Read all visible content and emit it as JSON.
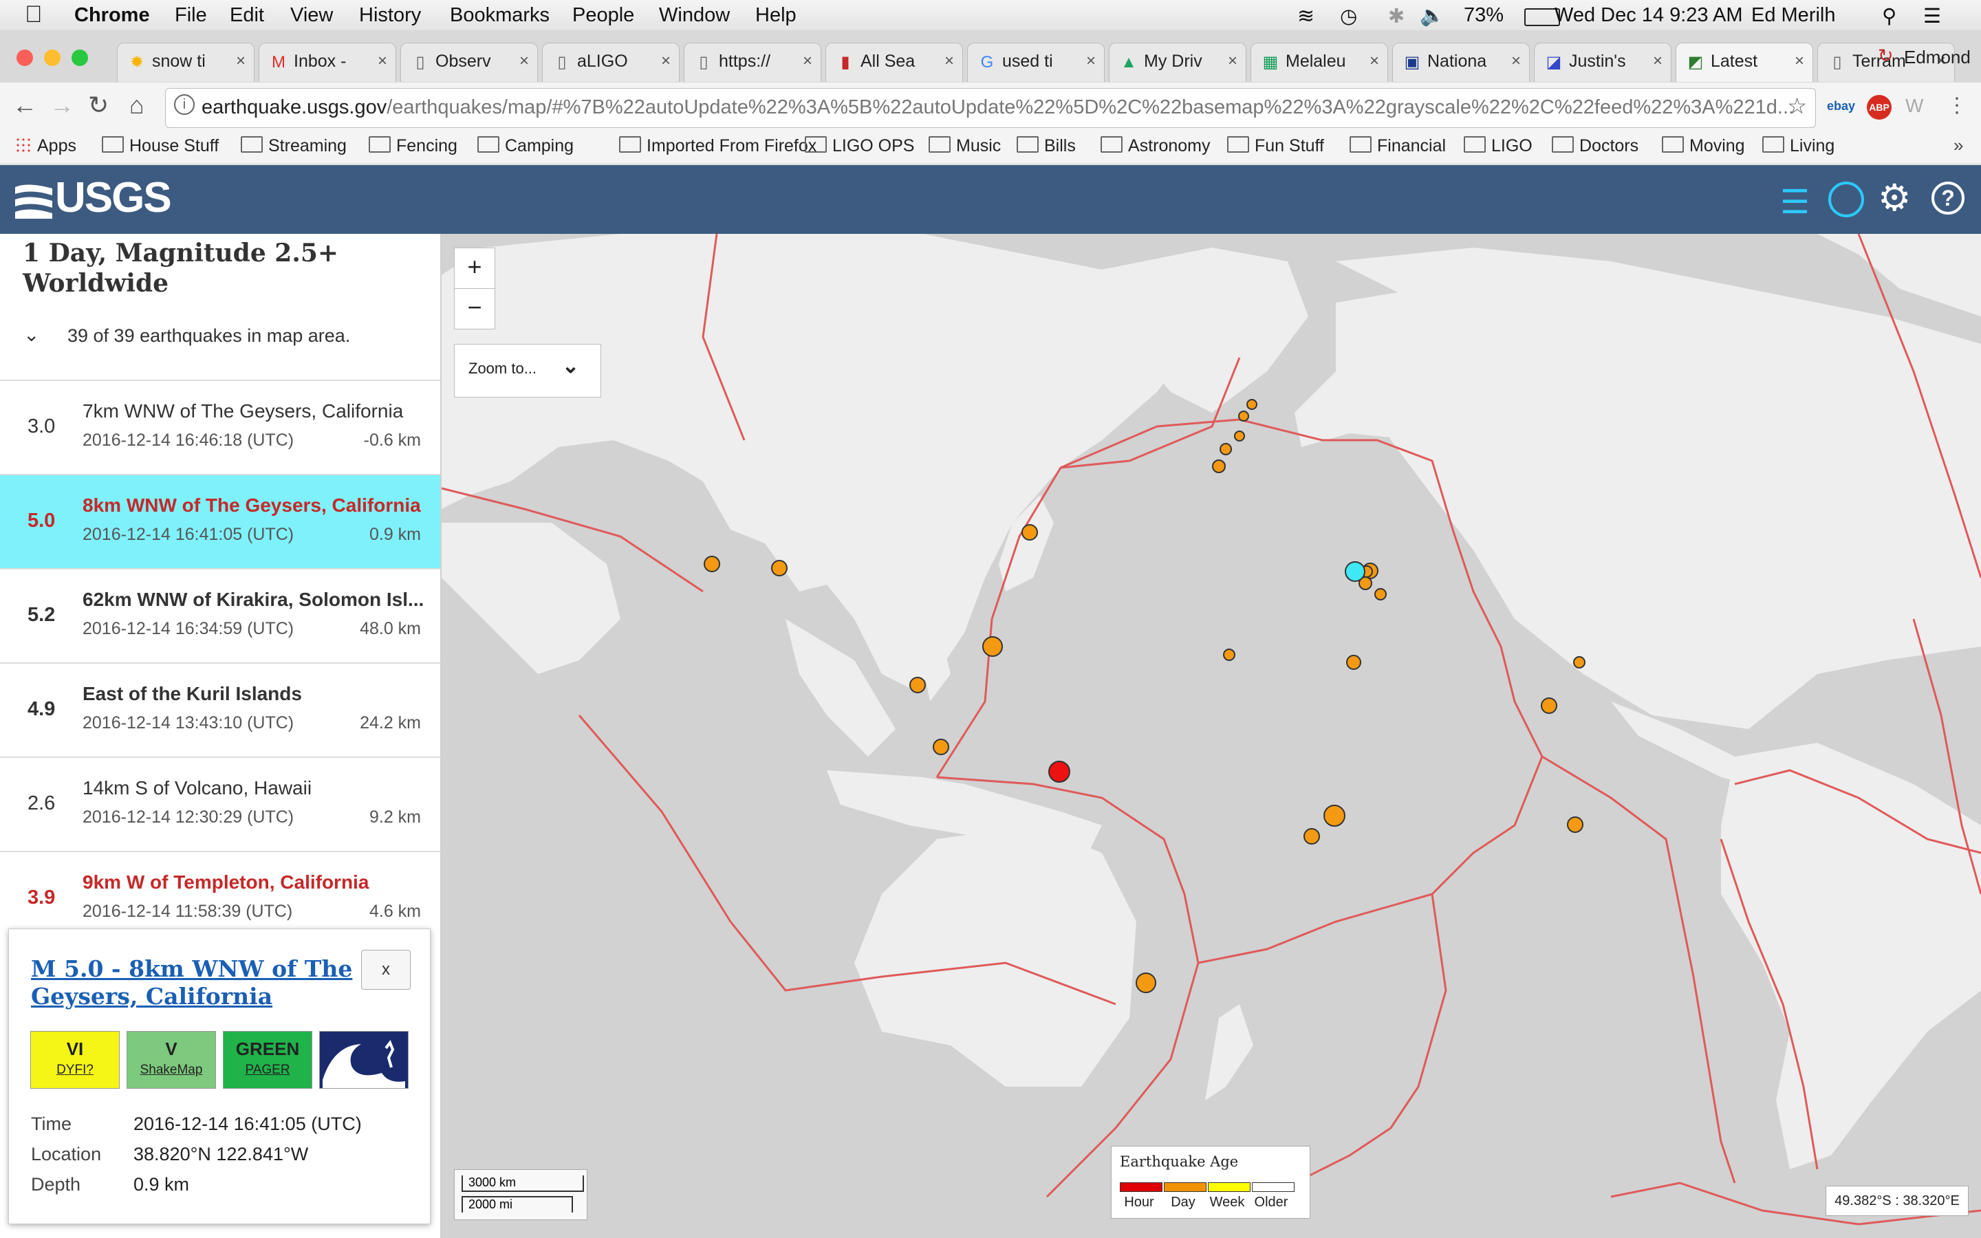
{
  "menubar": {
    "app": "Chrome",
    "items": [
      "File",
      "Edit",
      "View",
      "History",
      "Bookmarks",
      "People",
      "Window",
      "Help"
    ],
    "battery": "73%",
    "datetime": "Wed Dec 14  9:23 AM",
    "user": "Ed Merilh"
  },
  "tabs": [
    {
      "label": "snow ti",
      "icon": "walmart-icon"
    },
    {
      "label": "Inbox -",
      "icon": "gmail-icon"
    },
    {
      "label": "Observ",
      "icon": "page-icon"
    },
    {
      "label": "aLIGO",
      "icon": "page-icon"
    },
    {
      "label": "https://",
      "icon": "page-icon"
    },
    {
      "label": "All Sea",
      "icon": "ires-icon"
    },
    {
      "label": "used ti",
      "icon": "google-icon"
    },
    {
      "label": "My Driv",
      "icon": "drive-icon"
    },
    {
      "label": "Melaleu",
      "icon": "sheets-icon"
    },
    {
      "label": "Nationa",
      "icon": "weather-icon"
    },
    {
      "label": "Justin's",
      "icon": "blog-icon"
    },
    {
      "label": "Latest",
      "icon": "usgs-icon"
    },
    {
      "label": "Terram",
      "icon": "page-icon"
    }
  ],
  "profile": "Edmond",
  "address": {
    "host": "earthquake.usgs.gov",
    "path": "/earthquakes/map/#%7B%22autoUpdate%22%3A%5B%22autoUpdate%22%5D%2C%22basemap%22%3A%22grayscale%22%2C%22feed%22%3A%221d..."
  },
  "bookmarks": {
    "apps": "Apps",
    "folders": [
      "House Stuff",
      "Streaming",
      "Fencing",
      "Camping",
      "Imported From Firefox",
      "LIGO OPS",
      "Music",
      "Bills",
      "Astronomy",
      "Fun Stuff",
      "Financial",
      "LIGO",
      "Doctors",
      "Moving",
      "Living"
    ]
  },
  "usgs": {
    "logo": "USGS"
  },
  "panel": {
    "title": "1 Day, Magnitude 2.5+ Worldwide",
    "count": "39 of 39 earthquakes in map area."
  },
  "earthquakes": [
    {
      "mag": "3.0",
      "place": "7km WNW of The Geysers, California",
      "time": "2016-12-14 16:46:18 (UTC)",
      "depth": "-0.6 km"
    },
    {
      "mag": "5.0",
      "place": "8km WNW of The Geysers, California",
      "time": "2016-12-14 16:41:05 (UTC)",
      "depth": "0.9 km"
    },
    {
      "mag": "5.2",
      "place": "62km WNW of Kirakira, Solomon Isl...",
      "time": "2016-12-14 16:34:59 (UTC)",
      "depth": "48.0 km"
    },
    {
      "mag": "4.9",
      "place": "East of the Kuril Islands",
      "time": "2016-12-14 13:43:10 (UTC)",
      "depth": "24.2 km"
    },
    {
      "mag": "2.6",
      "place": "14km S of Volcano, Hawaii",
      "time": "2016-12-14 12:30:29 (UTC)",
      "depth": "9.2 km"
    },
    {
      "mag": "3.9",
      "place": "9km W of Templeton, California",
      "time": "2016-12-14 11:58:39 (UTC)",
      "depth": "4.6 km"
    }
  ],
  "popup": {
    "title": "M 5.0 - 8km WNW of The Geysers, California",
    "close": "x",
    "badges": [
      {
        "top": "VI",
        "bottom": "DYFI?",
        "color": "#f5f516"
      },
      {
        "top": "V",
        "bottom": "ShakeMap",
        "color": "#7dc97d"
      },
      {
        "top": "GREEN",
        "bottom": "PAGER",
        "color": "#1fb34a"
      }
    ],
    "time_label": "Time",
    "time": "2016-12-14 16:41:05 (UTC)",
    "location_label": "Location",
    "location": "38.820°N 122.841°W",
    "depth_label": "Depth",
    "depth": "0.9 km"
  },
  "map": {
    "zoom_in": "+",
    "zoom_out": "−",
    "zoom_to": "Zoom to...",
    "legend": {
      "title": "Earthquake Age",
      "items": [
        {
          "label": "Hour",
          "color": "#e00000"
        },
        {
          "label": "Day",
          "color": "#f39200"
        },
        {
          "label": "Week",
          "color": "#ffff00"
        },
        {
          "label": "Older",
          "color": "#ffffff"
        }
      ]
    },
    "scale_km": "3000 km",
    "scale_mi": "2000 mi",
    "coords": "49.382°S : 38.320°E",
    "colors": {
      "water": "#d2d2d2",
      "land": "#eeeeee",
      "plate": "#e05a5a",
      "day": "#f39a12",
      "hour": "#ee1111",
      "selected": "#3fe8f5"
    }
  }
}
